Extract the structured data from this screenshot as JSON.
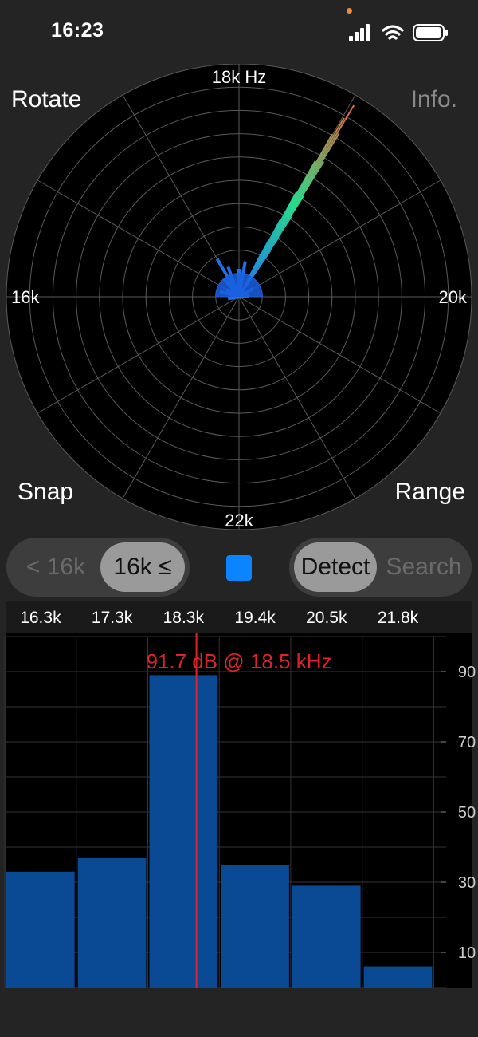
{
  "status_bar": {
    "time": "16:23"
  },
  "polar": {
    "labels": {
      "top": "18k Hz",
      "left": "16k",
      "right": "20k",
      "bottom": "22k"
    },
    "ring_count": 10,
    "spoke_count": 12
  },
  "controls": {
    "rotate": "Rotate",
    "info": "Info.",
    "snap": "Snap",
    "range": "Range"
  },
  "range_toggle": {
    "options": [
      "< 16k",
      "16k ≤"
    ],
    "selected": "16k ≤"
  },
  "mode_toggle": {
    "options": [
      "Detect",
      "Search"
    ],
    "selected": "Detect"
  },
  "color_indicator": "#0a84ff",
  "chart_data": {
    "type": "bar",
    "title": "",
    "categories": [
      "16.3k",
      "17.3k",
      "18.3k",
      "19.4k",
      "20.5k",
      "21.8k"
    ],
    "values": [
      33,
      37,
      89,
      35,
      29,
      6
    ],
    "ylim": [
      0,
      100
    ],
    "yticks": [
      "90",
      "70",
      "50",
      "30",
      "10"
    ],
    "ytick_values": [
      90,
      70,
      50,
      30,
      10
    ],
    "grid": true,
    "bar_color": "#0a4a94",
    "marker": {
      "frequency_khz": 18.5,
      "level_db": 91.7,
      "label": "91.7 dB @ 18.5 kHz",
      "color": "#e0222a"
    }
  }
}
